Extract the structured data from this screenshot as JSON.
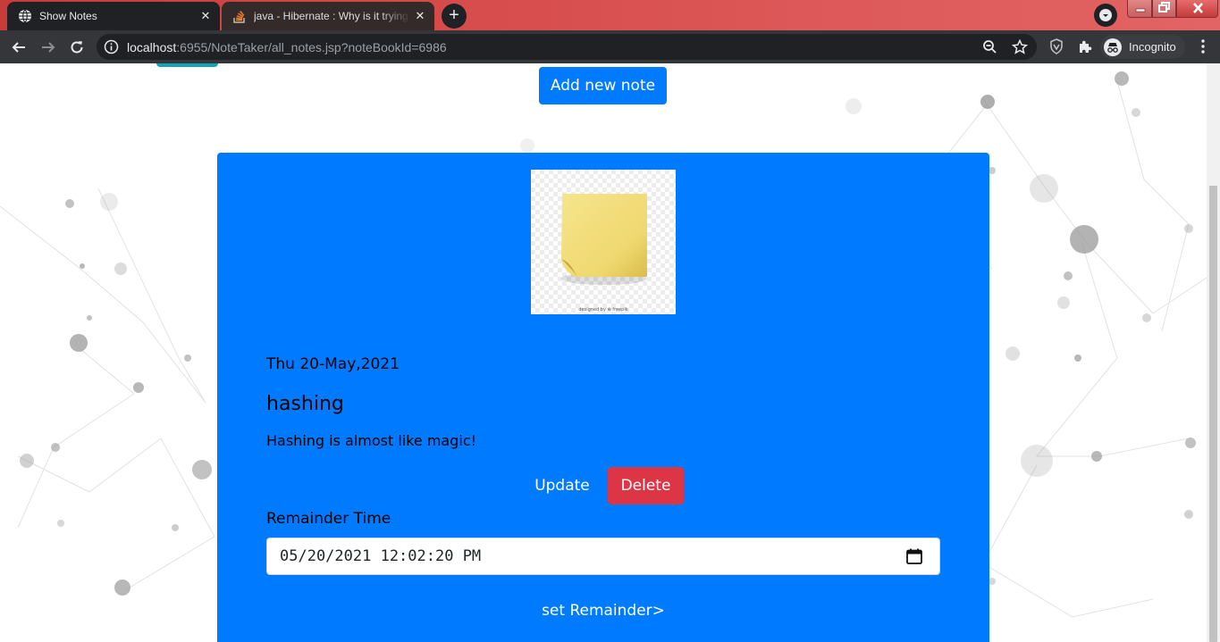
{
  "browser": {
    "tabs": [
      {
        "title": "Show Notes",
        "active": true,
        "icon": "globe-icon"
      },
      {
        "title": "java - Hibernate : Why is it trying",
        "active": false,
        "icon": "stackoverflow-icon"
      }
    ],
    "url": {
      "host": "localhost",
      "rest": ":6955/NoteTaker/all_notes.jsp?noteBookId=6986"
    },
    "profile_label": "Incognito"
  },
  "page": {
    "add_note_label": "Add new note",
    "note": {
      "image_icon": "sticky-note-image",
      "date": "Thu 20-May,2021",
      "title": "hashing",
      "content": "Hashing is almost like magic!",
      "update_label": "Update",
      "delete_label": "Delete",
      "reminder_label": "Remainder Time",
      "reminder_value": "05/20/2021 12:02:20 PM",
      "set_reminder_label": "set Remainder>"
    }
  },
  "colors": {
    "primary": "#007bff",
    "danger": "#dc3545",
    "info": "#17a2b8",
    "chrome_tab": "#202124",
    "chrome_toolbar": "#35363a"
  }
}
